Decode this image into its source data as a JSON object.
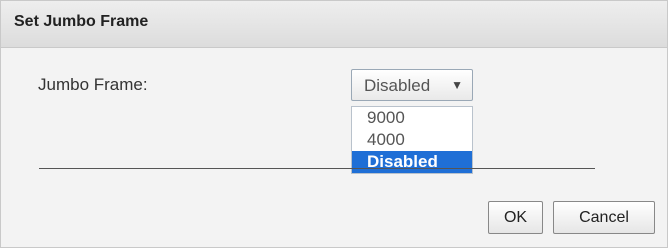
{
  "dialog": {
    "title": "Set Jumbo Frame",
    "field_label": "Jumbo Frame:",
    "select": {
      "value": "Disabled",
      "options": [
        "9000",
        "4000",
        "Disabled"
      ],
      "selected_index": 2
    },
    "buttons": {
      "ok": "OK",
      "cancel": "Cancel"
    }
  },
  "colors": {
    "selected_option_bg": "#1f6fd6",
    "dialog_bg": "#f3f3f3"
  }
}
